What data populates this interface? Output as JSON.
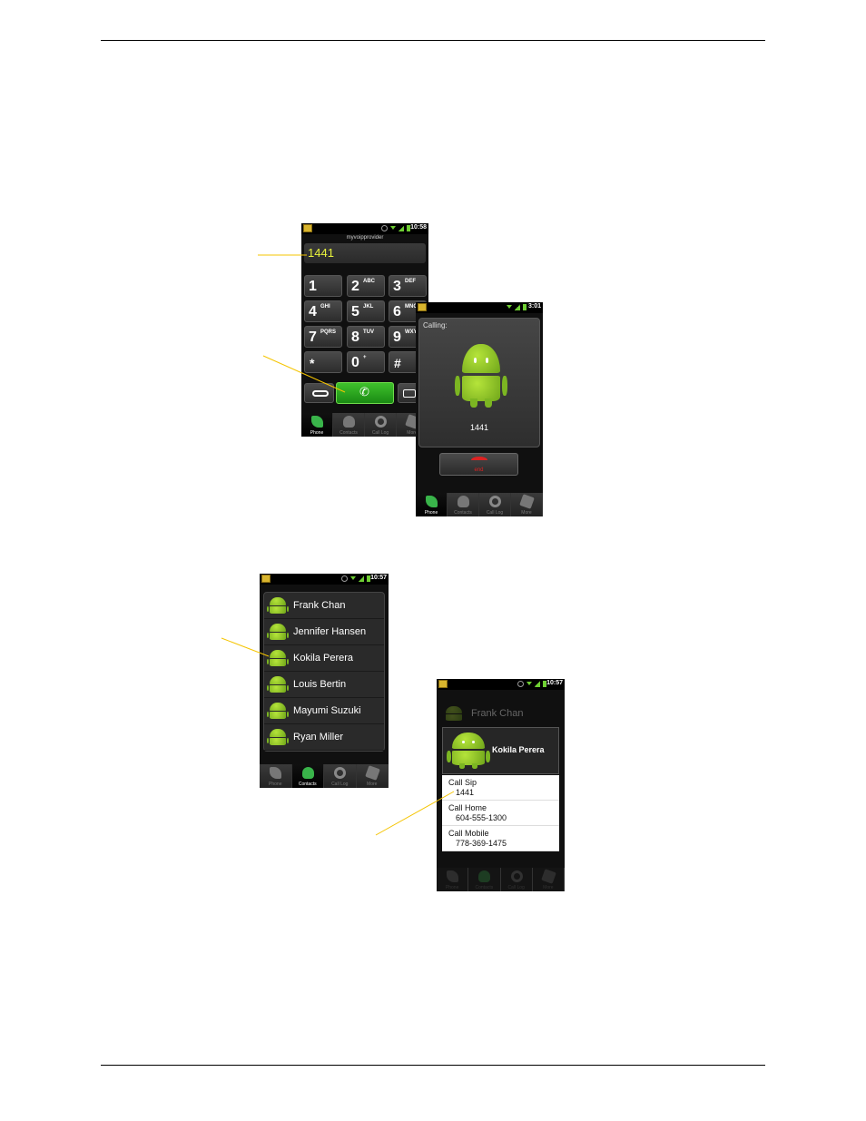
{
  "dialer": {
    "provider": "myvoipprovider",
    "time": "10:58",
    "number": "1441",
    "keys": [
      {
        "digit": "1",
        "letters": ""
      },
      {
        "digit": "2",
        "letters": "ABC"
      },
      {
        "digit": "3",
        "letters": "DEF"
      },
      {
        "digit": "4",
        "letters": "GHI"
      },
      {
        "digit": "5",
        "letters": "JKL"
      },
      {
        "digit": "6",
        "letters": "MNO"
      },
      {
        "digit": "7",
        "letters": "PQRS"
      },
      {
        "digit": "8",
        "letters": "TUV"
      },
      {
        "digit": "9",
        "letters": "WXYZ"
      },
      {
        "digit": "*",
        "letters": ""
      },
      {
        "digit": "0",
        "letters": "+"
      },
      {
        "digit": "#",
        "letters": ""
      }
    ]
  },
  "calling": {
    "time": "3:01",
    "label": "Calling:",
    "number": "1441",
    "end_label": "end"
  },
  "tabs": [
    "Phone",
    "Contacts",
    "Call Log",
    "More"
  ],
  "contacts": {
    "time": "10:57",
    "names": [
      "Frank Chan",
      "Jennifer Hansen",
      "Kokila Perera",
      "Louis Bertin",
      "Mayumi Suzuki",
      "Ryan Miller"
    ]
  },
  "options": {
    "time": "10:57",
    "background_name": "Frank Chan",
    "title": "Kokila Perera",
    "items": [
      {
        "label": "Call Sip",
        "value": "1441"
      },
      {
        "label": "Call Home",
        "value": "604-555-1300"
      },
      {
        "label": "Call Mobile",
        "value": "778-369-1475"
      }
    ]
  },
  "colors": {
    "callout": "#f5c400",
    "dial_number": "#e8f23c",
    "call_green": "#1a8a14"
  }
}
